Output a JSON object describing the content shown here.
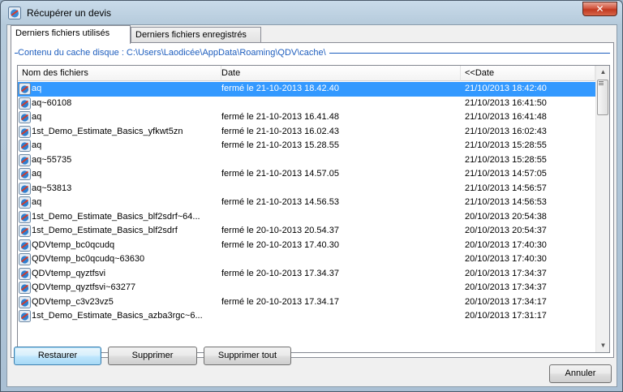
{
  "window": {
    "title": "Récupérer un devis",
    "close_label": "✕"
  },
  "tabs": [
    {
      "label": "Derniers fichiers utilisés",
      "active": true
    },
    {
      "label": "Derniers fichiers enregistrés",
      "active": false
    }
  ],
  "cache_label": "Contenu du cache disque : C:\\Users\\Laodicée\\AppData\\Roaming\\QDV\\cache\\",
  "columns": [
    "Nom des fichiers",
    "Date",
    "<<Date"
  ],
  "rows": [
    {
      "name": "aq",
      "status": "fermé le 21-10-2013 18.42.40",
      "date": "21/10/2013 18:42:40",
      "selected": true
    },
    {
      "name": "aq~60108",
      "status": "",
      "date": "21/10/2013 16:41:50"
    },
    {
      "name": "aq",
      "status": "fermé le 21-10-2013 16.41.48",
      "date": "21/10/2013 16:41:48"
    },
    {
      "name": "1st_Demo_Estimate_Basics_yfkwt5zn",
      "status": "fermé le 21-10-2013 16.02.43",
      "date": "21/10/2013 16:02:43"
    },
    {
      "name": "aq",
      "status": "fermé le 21-10-2013 15.28.55",
      "date": "21/10/2013 15:28:55"
    },
    {
      "name": "aq~55735",
      "status": "",
      "date": "21/10/2013 15:28:55"
    },
    {
      "name": "aq",
      "status": "fermé le 21-10-2013 14.57.05",
      "date": "21/10/2013 14:57:05"
    },
    {
      "name": "aq~53813",
      "status": "",
      "date": "21/10/2013 14:56:57"
    },
    {
      "name": "aq",
      "status": "fermé le 21-10-2013 14.56.53",
      "date": "21/10/2013 14:56:53"
    },
    {
      "name": "1st_Demo_Estimate_Basics_blf2sdrf~64...",
      "status": "",
      "date": "20/10/2013 20:54:38"
    },
    {
      "name": "1st_Demo_Estimate_Basics_blf2sdrf",
      "status": "fermé le 20-10-2013 20.54.37",
      "date": "20/10/2013 20:54:37"
    },
    {
      "name": "QDVtemp_bc0qcudq",
      "status": "fermé le 20-10-2013 17.40.30",
      "date": "20/10/2013 17:40:30"
    },
    {
      "name": "QDVtemp_bc0qcudq~63630",
      "status": "",
      "date": "20/10/2013 17:40:30"
    },
    {
      "name": "QDVtemp_qyztfsvi",
      "status": "fermé le 20-10-2013 17.34.37",
      "date": "20/10/2013 17:34:37"
    },
    {
      "name": "QDVtemp_qyztfsvi~63277",
      "status": "",
      "date": "20/10/2013 17:34:37"
    },
    {
      "name": "QDVtemp_c3v23vz5",
      "status": "fermé le 20-10-2013 17.34.17",
      "date": "20/10/2013 17:34:17"
    },
    {
      "name": "1st_Demo_Estimate_Basics_azba3rgc~6...",
      "status": "",
      "date": "20/10/2013 17:31:17"
    }
  ],
  "buttons": {
    "restore": "Restaurer",
    "delete": "Supprimer",
    "delete_all": "Supprimer tout",
    "cancel": "Annuler"
  },
  "colors": {
    "selection": "#3399ff",
    "cache_label": "#1e5ebe",
    "close_button": "#c03a20"
  }
}
